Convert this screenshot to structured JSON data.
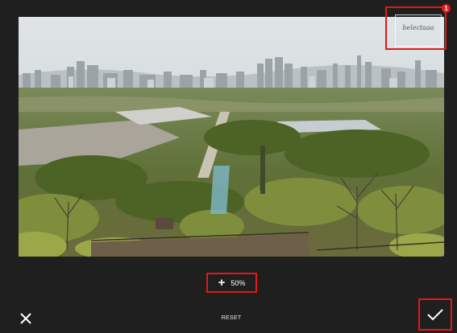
{
  "editor": {
    "zoom": {
      "value": "50%",
      "plus_icon": "plus-icon"
    },
    "reset_label": "RESET",
    "watermark": {
      "signature": "belectaaa",
      "badge": "1"
    },
    "icons": {
      "close": "close-icon",
      "confirm": "checkmark-icon"
    },
    "accent_color": "#e01919"
  }
}
